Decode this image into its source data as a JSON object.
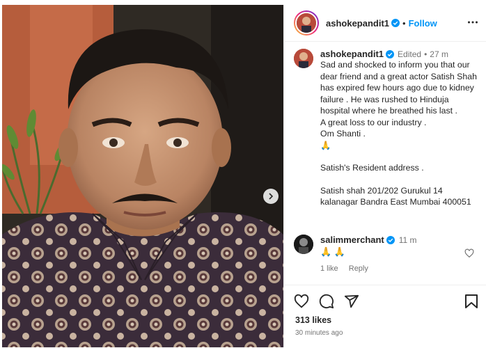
{
  "post": {
    "username": "ashokepandit1",
    "follow_label": "Follow",
    "dot": "•"
  },
  "caption": {
    "username": "ashokepandit1",
    "edited": "Edited",
    "dot": "•",
    "age": "27 m",
    "lines": [
      "Sad and shocked to inform you that our dear friend and a great actor Satish Shah has expired few hours ago due to kidney failure . He was rushed to Hinduja hospital where he breathed his last .",
      "A great loss to our industry .",
      "Om Shanti .",
      "🙏"
    ],
    "address_title": "Satish's Resident address .",
    "address": "Satish shah 201/202 Gurukul 14 kalanagar Bandra East Mumbai 400051"
  },
  "comment": {
    "username": "salimmerchant",
    "age": "11 m",
    "text": "🙏 🙏",
    "likes_label": "1 like",
    "reply_label": "Reply"
  },
  "footer": {
    "likes": "313 likes",
    "time": "30 minutes ago"
  },
  "colors": {
    "link_blue": "#0095f6",
    "verified_blue": "#0095f6",
    "muted": "#737373"
  },
  "icons": {
    "more": "more-icon",
    "next": "chevron-right-icon",
    "like": "heart-icon",
    "comment": "comment-icon",
    "share": "share-icon",
    "save": "bookmark-icon"
  }
}
